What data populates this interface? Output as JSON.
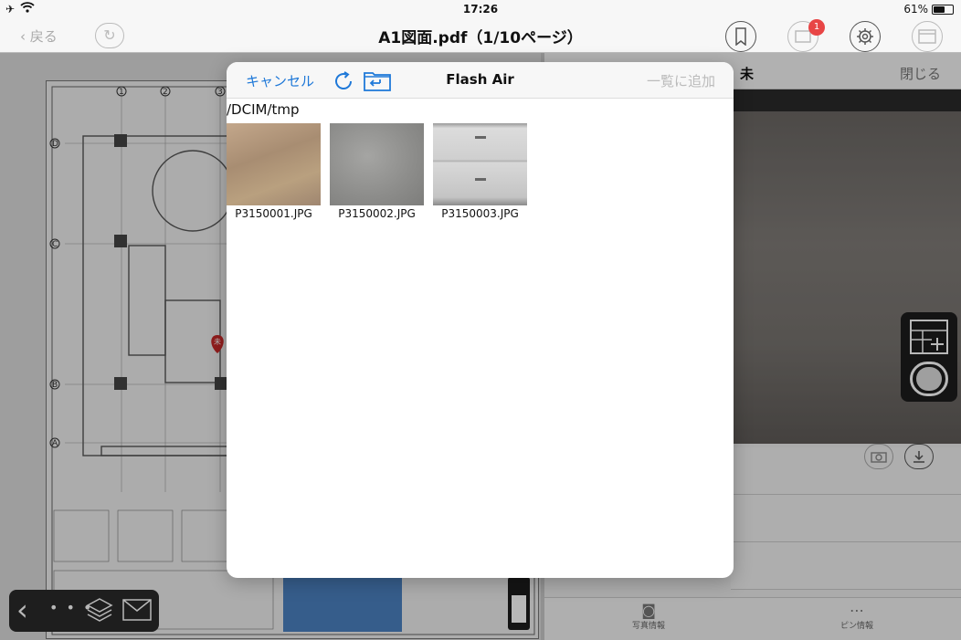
{
  "status_bar": {
    "time": "17:26",
    "battery_text": "61%",
    "battery_level": 0.61,
    "airplane_icon": "airplane-icon",
    "wifi_icon": "wifi-icon"
  },
  "nav_bar": {
    "back_label": "戻る",
    "title": "A1図面.pdf（1/10ページ）",
    "notification_count": "1"
  },
  "right_panel": {
    "status_label": "未",
    "close_label": "閉じる",
    "tabs": [
      "写真情報",
      "ピン情報"
    ]
  },
  "modal": {
    "cancel_label": "キャンセル",
    "title": "Flash Air",
    "add_to_list_label": "一覧に追加",
    "path": "/DCIM/tmp",
    "files": [
      {
        "name": "P3150001.JPG"
      },
      {
        "name": "P3150002.JPG"
      },
      {
        "name": "P3150003.JPG"
      }
    ]
  },
  "drawing": {
    "grid_labels": [
      "D",
      "C",
      "B",
      "A"
    ],
    "column_labels": [
      "1",
      "2",
      "3"
    ],
    "pin_label": "未"
  },
  "colors": {
    "accent": "#1e78d8",
    "badge": "#e84545",
    "pin": "#c62828"
  }
}
